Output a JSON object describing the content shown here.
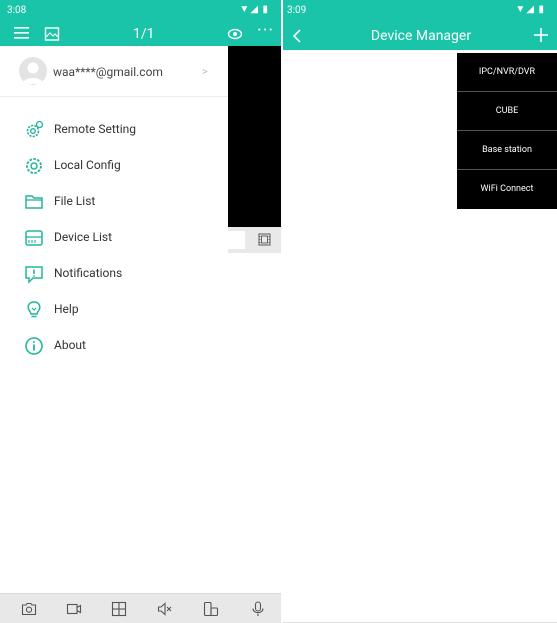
{
  "left_screen": {
    "status_bar": {
      "time": "3:08",
      "signal": "▼◢ ▮"
    },
    "app_bar": {
      "page_count": "1/1",
      "more": "···"
    },
    "drawer": {
      "account_email": "waa****@gmail.com",
      "account_chevron": ">",
      "menu_items": [
        {
          "label": "Remote Setting",
          "icon": "remote-gear-icon"
        },
        {
          "label": "Local Config",
          "icon": "gear-icon"
        },
        {
          "label": "File List",
          "icon": "folder-icon"
        },
        {
          "label": "Device List",
          "icon": "device-list-icon"
        },
        {
          "label": "Notifications",
          "icon": "notification-icon"
        },
        {
          "label": "Help",
          "icon": "lightbulb-icon"
        },
        {
          "label": "About",
          "icon": "info-icon"
        }
      ]
    },
    "bottom_toolbar": [
      "camera-icon",
      "video-record-icon",
      "grid-icon",
      "mute-icon",
      "device-switch-icon",
      "microphone-icon"
    ]
  },
  "right_screen": {
    "status_bar": {
      "time": "3:09",
      "signal": "▼◢ ▮"
    },
    "app_bar": {
      "title": "Device Manager"
    },
    "dropdown_items": [
      "IPC/NVR/DVR",
      "CUBE",
      "Base station",
      "WiFi Connect"
    ]
  },
  "colors": {
    "accent": "#19c4a8",
    "icon": "#22b59c",
    "dropdown_bg": "#000000"
  }
}
